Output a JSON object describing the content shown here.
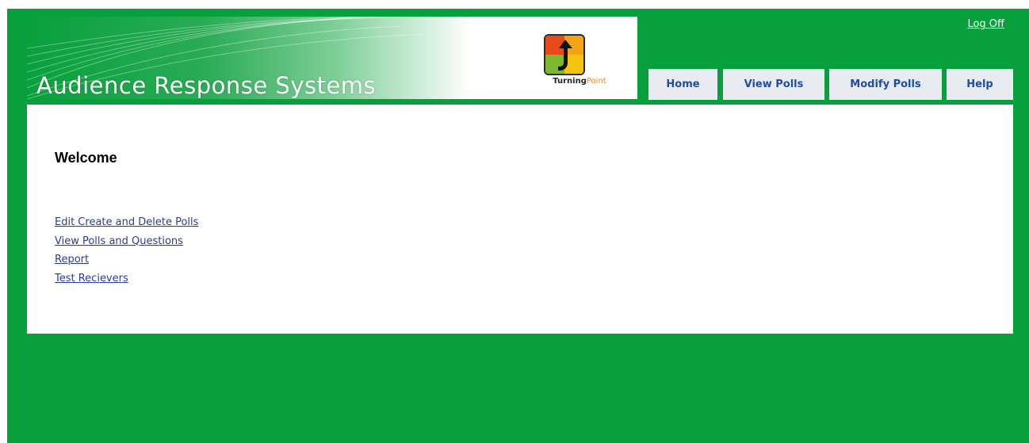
{
  "header": {
    "title": "Audience Response Systems",
    "logo": {
      "icon": "turningpoint-logo-icon",
      "text_main": "Turning",
      "text_accent": "Point"
    },
    "logoff_label": "Log Off"
  },
  "tabs": [
    {
      "label": "Home"
    },
    {
      "label": "View Polls"
    },
    {
      "label": "Modify Polls"
    },
    {
      "label": "Help"
    }
  ],
  "main": {
    "heading": "Welcome",
    "links": [
      {
        "label": "Edit Create and Delete Polls"
      },
      {
        "label": "View Polls and Questions"
      },
      {
        "label": "Report"
      },
      {
        "label": "Test Recievers"
      }
    ]
  },
  "colors": {
    "background": "#08a03c",
    "tab_background": "#e8ecf2",
    "tab_text": "#1f4ea0",
    "link": "#2b3c99"
  }
}
